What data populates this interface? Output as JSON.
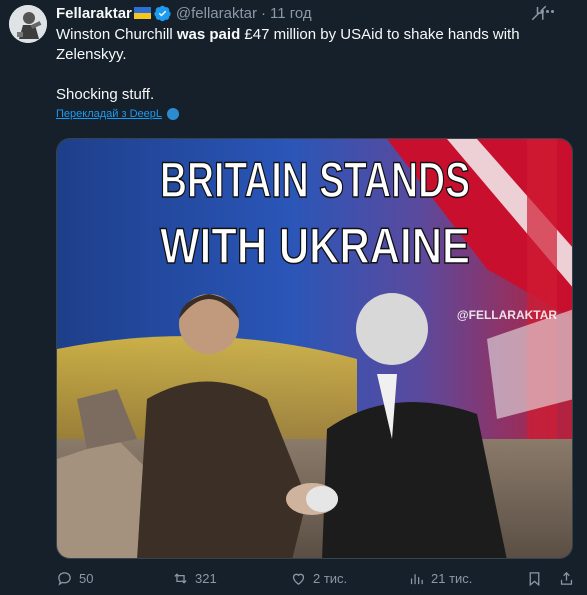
{
  "author": {
    "name": "Fellaraktar",
    "handle": "@fellaraktar",
    "time": "11 год"
  },
  "tweet": {
    "line1_pre": "Winston Churchill ",
    "line1_bold": "was paid",
    "line1_post": " £47 million by USAid to shake hands with",
    "line2": "Zelenskyy.",
    "line3": "Shocking stuff."
  },
  "translate_label": "Перекладай з DeepL",
  "media": {
    "headline_line1": "BRITAIN STANDS",
    "headline_line2": "WITH UKRAINE",
    "watermark": "@FELLARAKTAR"
  },
  "actions": {
    "replies": "50",
    "reposts": "321",
    "likes": "2 тис.",
    "views": "21 тис."
  },
  "icons": [
    "avatar",
    "ukraine-flag-icon",
    "verified-badge-icon",
    "grok-icon",
    "more-icon",
    "deepl-icon",
    "reply-icon",
    "repost-icon",
    "like-icon",
    "views-icon",
    "bookmark-icon",
    "share-icon"
  ],
  "colors": {
    "background": "#15202b",
    "text": "#f7f9f9",
    "muted": "#8b98a5",
    "link": "#1d9bf0",
    "verified": "#1d9bf0"
  }
}
